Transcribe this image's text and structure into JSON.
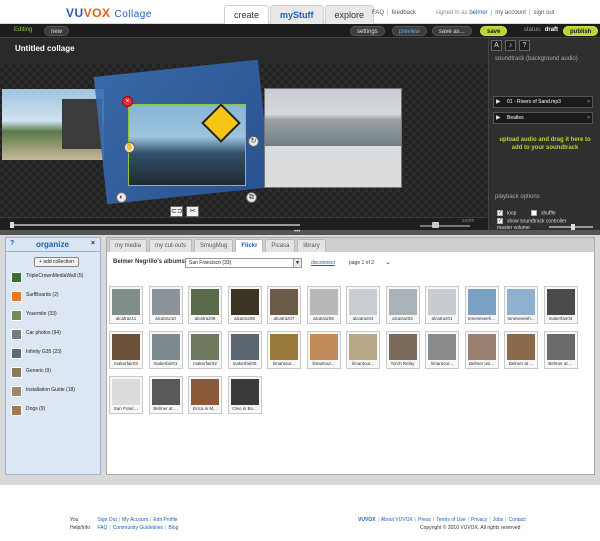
{
  "logo": {
    "vu": "VU",
    "vox": "VOX",
    "sub": "Collage"
  },
  "nav_tabs": [
    "create",
    "myStuff",
    "explore"
  ],
  "top_links": {
    "faq": "FAQ",
    "feedback": "feedback",
    "signed_in_as": "signed in as",
    "username": "belmer",
    "my_account": "my account",
    "sign_out": "sign out"
  },
  "editor": {
    "mode_label": "Editing",
    "new_label": "new",
    "settings_label": "settings",
    "preview_label": "preview",
    "save_as_label": "save as...",
    "save_label": "save",
    "status_label": "status:",
    "status_value": "draft",
    "publish_label": "publish",
    "collage_title": "Untitled collage",
    "zoom_label": "zoom"
  },
  "soundtrack": {
    "tab_labels": [
      "A",
      "♪",
      "?"
    ],
    "header": "soundtrack (background audio)",
    "tracks": [
      "01 - Rivers of Sand.mp3",
      "Beatles"
    ],
    "upload_message": "upload audio and drag it here to add to your soundtrack",
    "playback_header": "playback options",
    "loop_label": "loop",
    "shuffle_label": "shuffle",
    "show_controller_label": "show soundtrack controller",
    "master_volume_label": "master volume",
    "loop_checked": true,
    "shuffle_checked": false,
    "show_controller_checked": true,
    "master_volume": 0.55
  },
  "organize": {
    "title": "organize",
    "add_label": "+ add collection",
    "collections": [
      {
        "name": "TripleCrownMediaWall (5)",
        "color": "#3b6e33"
      },
      {
        "name": "SurfBoards (2)",
        "color": "#e07a2c"
      },
      {
        "name": "Yosemite (33)",
        "color": "#6b8e5a"
      },
      {
        "name": "Car photos (94)",
        "color": "#7a7a7a"
      },
      {
        "name": "Infinity G35 (23)",
        "color": "#5a6b7a"
      },
      {
        "name": "Generic (9)",
        "color": "#8a7a5a"
      },
      {
        "name": "Installation Guide (18)",
        "color": "#9a8a6a"
      },
      {
        "name": "Dogs (9)",
        "color": "#a07a4a"
      }
    ]
  },
  "media": {
    "tabs": [
      "my media",
      "my cut-outs",
      "SmugMug",
      "Flickr",
      "Picasa",
      "library"
    ],
    "active_tab": "Flickr",
    "album_label": "Belmer Negrillo's albums",
    "album_selected": "San Francisco (33)",
    "disconnect_label": "disconnect",
    "page_info": "page 1 of 2",
    "thumbnails": [
      {
        "caption": "alcatraz11",
        "color": "#7f8e8a"
      },
      {
        "caption": "alcatraz10",
        "color": "#8c949a"
      },
      {
        "caption": "alcatraz09",
        "color": "#5a6a4a"
      },
      {
        "caption": "alcatraz08",
        "color": "#3b3324"
      },
      {
        "caption": "alcatraz07",
        "color": "#6a5a48"
      },
      {
        "caption": "alcatraz05",
        "color": "#b8b8b8"
      },
      {
        "caption": "alcatraz04",
        "color": "#c8cdd1"
      },
      {
        "caption": "alcatraz02",
        "color": "#a9b2b6"
      },
      {
        "caption": "alcatraz01",
        "color": "#c7ccd0"
      },
      {
        "caption": "teneseseeh...",
        "color": "#7aa0c4"
      },
      {
        "caption": "teneseseeh...",
        "color": "#8fb0cf"
      },
      {
        "caption": "makerfair04",
        "color": "#4a4a4a"
      },
      {
        "caption": "makerfair03",
        "color": "#6a5038"
      },
      {
        "caption": "makerfair01",
        "color": "#7d8a8f"
      },
      {
        "caption": "makerfair02",
        "color": "#6f7a60"
      },
      {
        "caption": "makerfair00",
        "color": "#5b6670"
      },
      {
        "caption": "limantour...",
        "color": "#9a7a3a"
      },
      {
        "caption": "limantour...",
        "color": "#c08a5a"
      },
      {
        "caption": "limantour...",
        "color": "#b8a888"
      },
      {
        "caption": "Torch Relay",
        "color": "#7a6a5a"
      },
      {
        "caption": "limantour...",
        "color": "#8a8a8a"
      },
      {
        "caption": "Belmer usi...",
        "color": "#9a8070"
      },
      {
        "caption": "Belmer at ...",
        "color": "#8a6a4a"
      },
      {
        "caption": "Belmer at ...",
        "color": "#6a6a6a"
      },
      {
        "caption": "San Franc...",
        "color": "#dcdcdc"
      },
      {
        "caption": "Belmer at ...",
        "color": "#5a5a5a"
      },
      {
        "caption": "Erica in M...",
        "color": "#8a5a3a"
      },
      {
        "caption": "Cleo in Bo...",
        "color": "#3a3a3a"
      }
    ]
  },
  "footer": {
    "you_label": "You",
    "you_links": [
      "Sign Out",
      "My Account",
      "Edit Profile"
    ],
    "help_label": "Help/Info",
    "help_links": [
      "FAQ",
      "Community Guidelines",
      "Blog"
    ],
    "company_links": [
      "VUVOX",
      "About VUVOX",
      "Press",
      "Terms of Use",
      "Privacy",
      "Jobs",
      "Contact"
    ],
    "copyright": "Copyright © 2010 VUVOX. All rights reserved"
  }
}
